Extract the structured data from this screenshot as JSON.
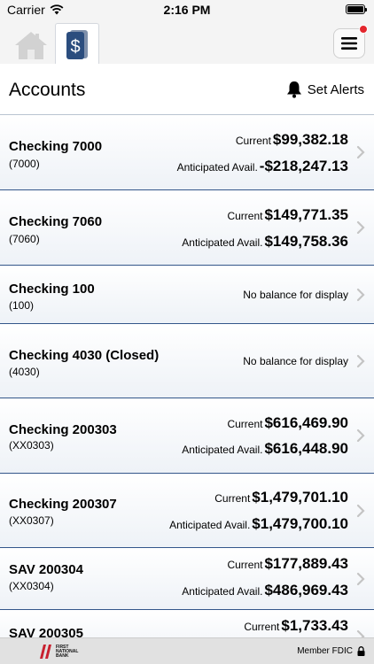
{
  "status_bar": {
    "carrier": "Carrier",
    "time": "2:16 PM"
  },
  "header": {
    "title": "Accounts",
    "set_alerts": "Set Alerts"
  },
  "accounts": [
    {
      "name": "Checking 7000",
      "number": "(7000)",
      "current_label": "Current",
      "current": "$99,382.18",
      "avail_label": "Anticipated Avail.",
      "avail": "-$218,247.13"
    },
    {
      "name": "Checking 7060",
      "number": "(7060)",
      "current_label": "Current",
      "current": "$149,771.35",
      "avail_label": "Anticipated Avail.",
      "avail": "$149,758.36"
    },
    {
      "name": "Checking 100",
      "number": "(100)",
      "no_balance": "No balance for display"
    },
    {
      "name": "Checking 4030 (Closed)",
      "number": "(4030)",
      "no_balance": "No balance for display"
    },
    {
      "name": "Checking 200303",
      "number": "(XX0303)",
      "current_label": "Current",
      "current": "$616,469.90",
      "avail_label": "Anticipated Avail.",
      "avail": "$616,448.90"
    },
    {
      "name": "Checking 200307",
      "number": "(XX0307)",
      "current_label": "Current",
      "current": "$1,479,701.10",
      "avail_label": "Anticipated Avail.",
      "avail": "$1,479,700.10"
    },
    {
      "name": "SAV 200304",
      "number": "(XX0304)",
      "current_label": "Current",
      "current": "$177,889.43",
      "avail_label": "Anticipated Avail.",
      "avail": "$486,969.43"
    },
    {
      "name": "SAV 200305",
      "current_label": "Current",
      "current": "$1,733.43"
    }
  ],
  "footer": {
    "logo_line1": "FIRST",
    "logo_line2": "NATIONAL",
    "logo_line3": "BANK",
    "fdic": "Member FDIC"
  },
  "colors": {
    "accent": "#2b4d7e",
    "divider": "#33568a",
    "badge": "#e3262d",
    "logo_red": "#c8202f"
  },
  "icons": {
    "home_tab": "home-icon",
    "accounts_tab": "dollar-icon",
    "menu": "hamburger-menu-icon",
    "alerts": "bell-icon",
    "row": "chevron-right-icon",
    "footer": "lock-icon"
  }
}
